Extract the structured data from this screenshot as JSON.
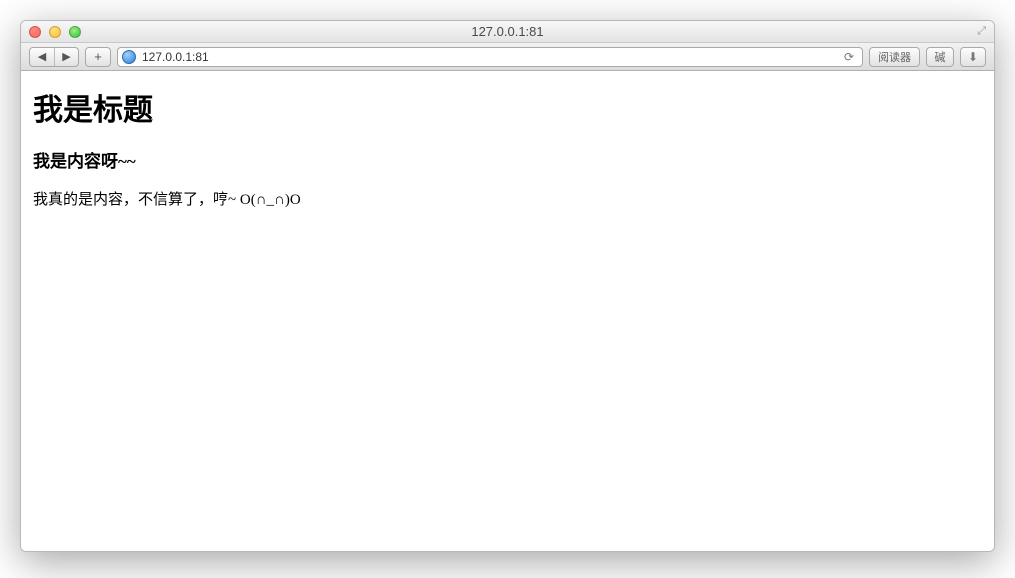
{
  "window": {
    "title": "127.0.0.1:81"
  },
  "toolbar": {
    "addTab": "+",
    "url": "127.0.0.1:81",
    "reload": "⟳",
    "reader": "阅读器",
    "zoom_label": "碱"
  },
  "page": {
    "heading": "我是标题",
    "subheading": "我是内容呀~~",
    "body_text": "我真的是内容，不信算了，哼~ O(∩_∩)O"
  }
}
